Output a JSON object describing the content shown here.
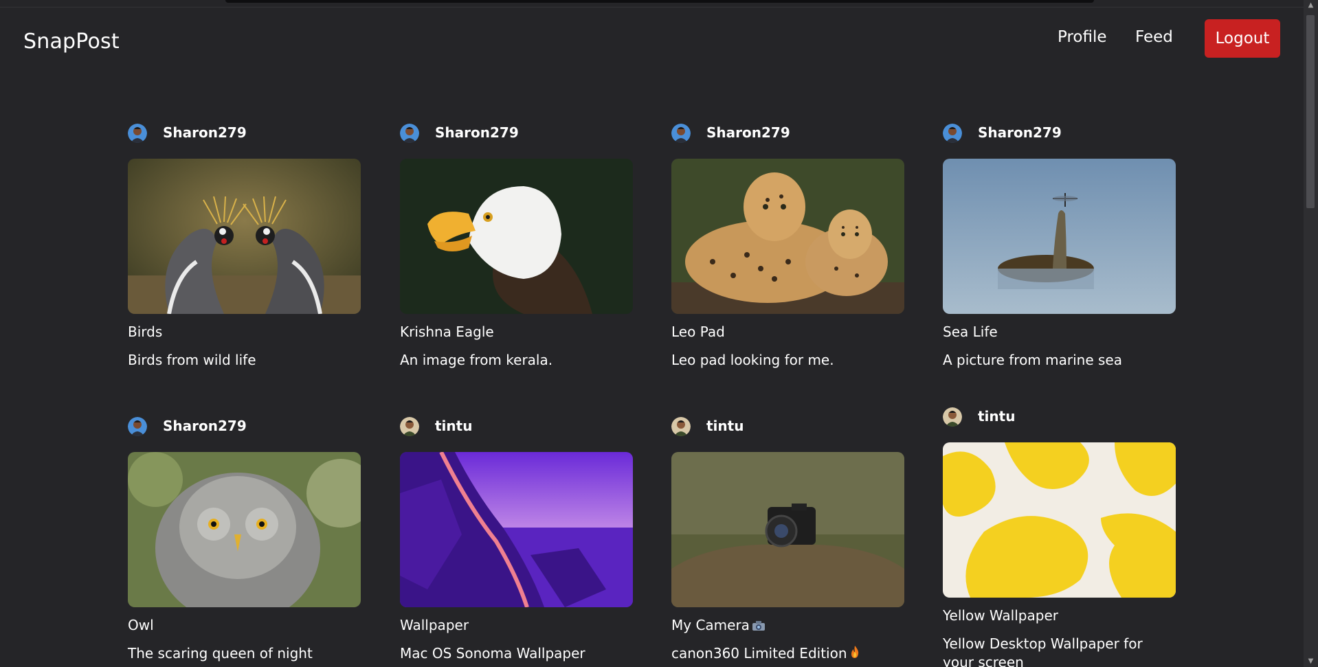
{
  "app": {
    "brand": "SnapPost"
  },
  "nav": {
    "profile": "Profile",
    "feed": "Feed",
    "logout": "Logout"
  },
  "posts": [
    {
      "username": "Sharon279",
      "title": "Birds",
      "description": "Birds from wild life",
      "image": "crowned-cranes-photo",
      "avatar": "avatar-sharon"
    },
    {
      "username": "Sharon279",
      "title": "Krishna Eagle",
      "description": "An image from kerala.",
      "image": "bald-eagle-photo",
      "avatar": "avatar-sharon"
    },
    {
      "username": "Sharon279",
      "title": "Leo Pad",
      "description": "Leo pad looking for me.",
      "image": "leopards-photo",
      "avatar": "avatar-sharon"
    },
    {
      "username": "Sharon279",
      "title": "Sea Life",
      "description": "A picture from marine sea",
      "image": "turtle-dragonfly-photo",
      "avatar": "avatar-sharon"
    },
    {
      "username": "Sharon279",
      "title": "Owl",
      "description": "The scaring queen of night",
      "image": "owl-photo",
      "avatar": "avatar-sharon"
    },
    {
      "username": "tintu",
      "title": "Wallpaper",
      "description": "Mac OS Sonoma Wallpaper",
      "image": "sonoma-wallpaper",
      "avatar": "avatar-tintu"
    },
    {
      "username": "tintu",
      "title": "My Camera",
      "title_emoji": "camera-emoji",
      "description": "canon360 Limited Edition",
      "description_emoji": "fire-emoji",
      "image": "camera-on-rock-photo",
      "avatar": "avatar-tintu"
    },
    {
      "username": "tintu",
      "title": "Yellow Wallpaper",
      "description": "Yellow Desktop Wallpaper for your screen",
      "image": "yellow-abstract-wallpaper",
      "avatar": "avatar-tintu"
    }
  ],
  "colors": {
    "background": "#252528",
    "logout": "#c82121",
    "text": "#ffffff"
  }
}
